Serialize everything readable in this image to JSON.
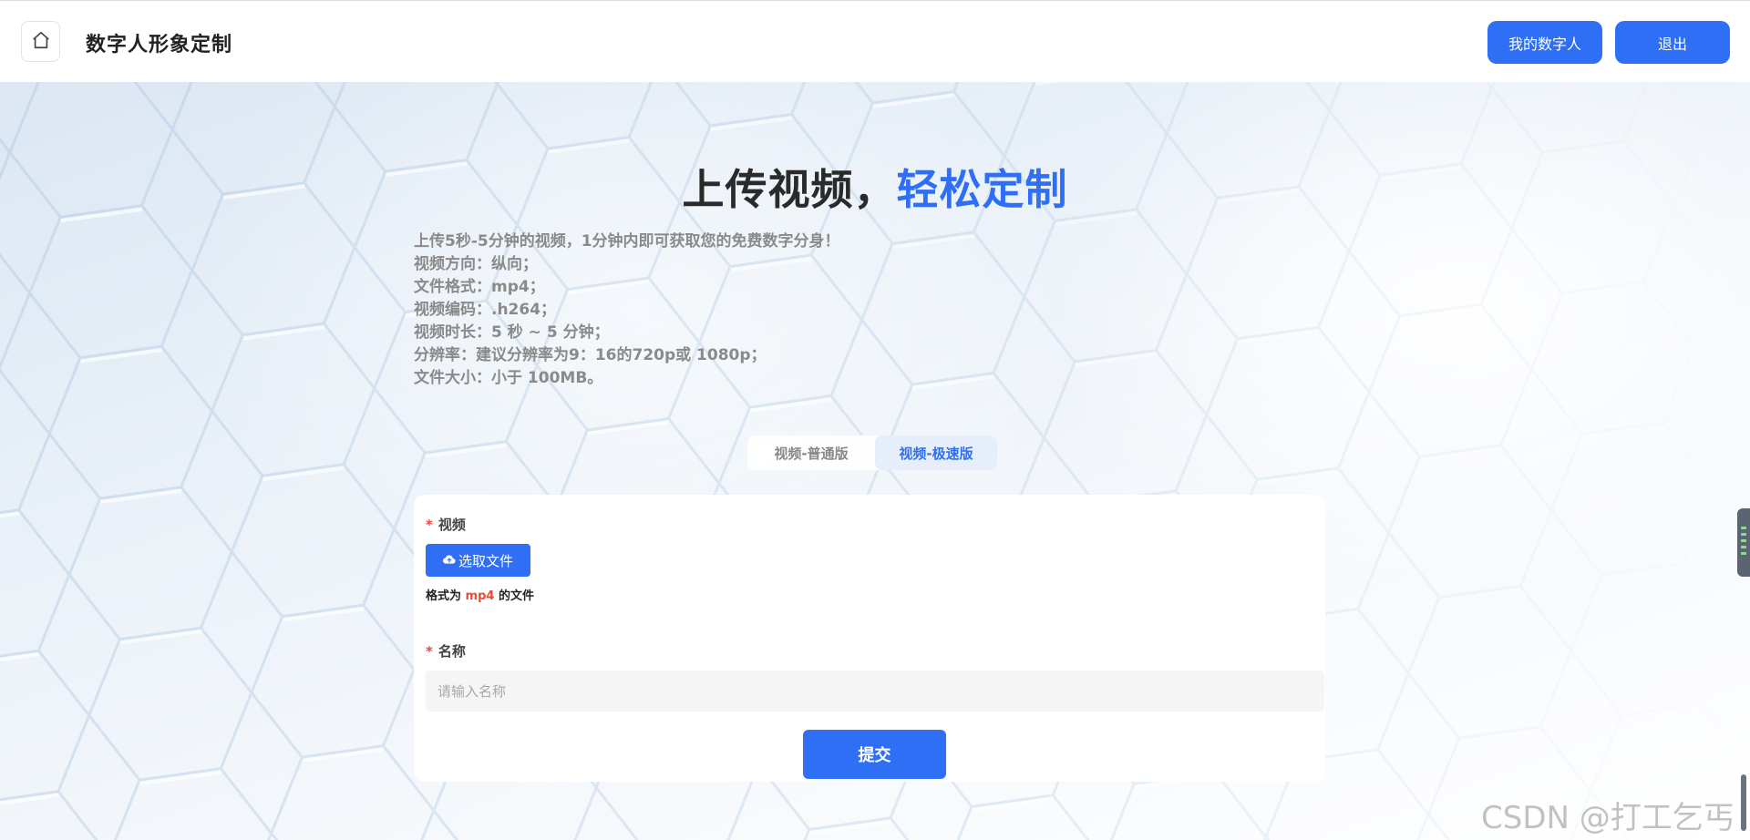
{
  "header": {
    "title": "数字人形象定制",
    "buttons": {
      "mine": "我的数字人",
      "logout": "退出"
    }
  },
  "hero": {
    "title_main": "上传视频，",
    "title_accent": "轻松定制",
    "requirements": [
      "上传5秒-5分钟的视频，1分钟内即可获取您的免费数字分身！",
      "视频方向：纵向；",
      "文件格式：mp4；",
      "视频编码：.h264；",
      "视频时长：5 秒 ~ 5 分钟；",
      "分辨率：建议分辨率为9：16的720p或 1080p；",
      "文件大小：小于 100MB。"
    ]
  },
  "tabs": [
    {
      "label": "视频-普通版",
      "active": false
    },
    {
      "label": "视频-极速版",
      "active": true
    }
  ],
  "form": {
    "video_label": "视频",
    "required_mark": "*",
    "upload_button": "选取文件",
    "hint_prefix": "格式为",
    "hint_format": "mp4",
    "hint_suffix": "的文件",
    "name_label": "名称",
    "name_value": "",
    "name_placeholder": "请输入名称",
    "submit_button": "提交"
  },
  "watermark": "CSDN @打工乞丐",
  "colors": {
    "accent": "#2f6ff5",
    "required": "#e64b3c"
  },
  "icons": {
    "home": "home-icon",
    "upload": "cloud-upload-icon"
  }
}
